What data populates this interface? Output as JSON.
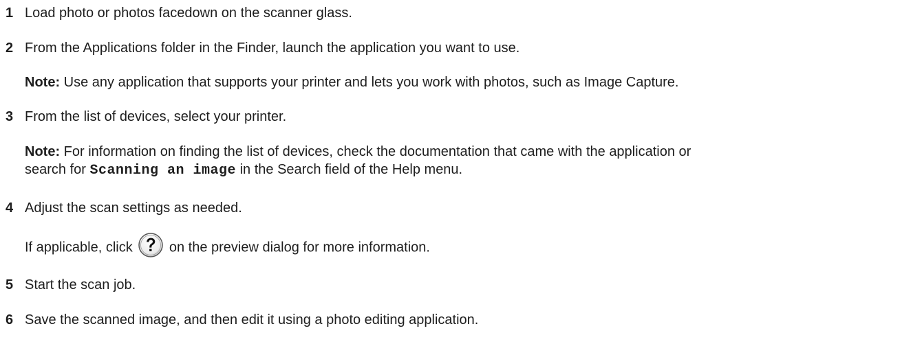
{
  "steps": [
    {
      "num": "1",
      "text": "Load photo or photos facedown on the scanner glass."
    },
    {
      "num": "2",
      "text": "From the Applications folder in the Finder, launch the application you want to use."
    },
    {
      "num": "3",
      "text": "From the list of devices, select your printer."
    },
    {
      "num": "4",
      "text": "Adjust the scan settings as needed."
    },
    {
      "num": "5",
      "text": "Start the scan job."
    },
    {
      "num": "6",
      "text": "Save the scanned image, and then edit it using a photo editing application."
    }
  ],
  "note1": {
    "label": "Note:",
    "text": " Use any application that supports your printer and lets you work with photos, such as Image Capture."
  },
  "note2": {
    "label": "Note:",
    "line1": " For information on finding the list of devices, check the documentation that came with the application or",
    "line2_pre": "search for ",
    "code": "Scanning an image",
    "line2_post": " in the Search field of the Help menu."
  },
  "step4_sub": {
    "pre": "If applicable, click ",
    "icon": "help-question-icon",
    "post": " on the preview dialog for more information."
  }
}
